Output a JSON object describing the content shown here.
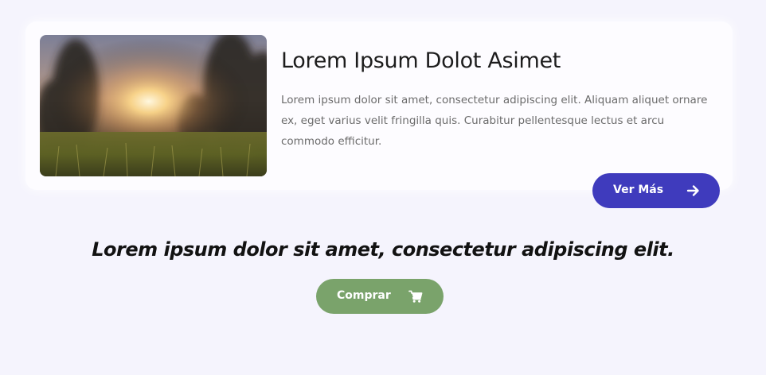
{
  "card": {
    "title": "Lorem Ipsum Dolot Asimet",
    "text": "Lorem ipsum dolor sit amet, consectetur adipiscing elit. Aliquam aliquet ornare ex, eget varius velit fringilla quis. Curabitur pellentesque lectus et arcu commodo efficitur.",
    "button_label": "Ver Más",
    "button_icon": "arrow-right-icon",
    "button_color": "#3f3bbd"
  },
  "tagline": "Lorem ipsum dolor sit amet, consectetur adipiscing elit.",
  "buy": {
    "button_label": "Comprar",
    "button_icon": "shopping-cart-icon",
    "button_color": "#7aa36b"
  },
  "colors": {
    "background": "#f5f4fd",
    "card": "#fdfcff"
  }
}
